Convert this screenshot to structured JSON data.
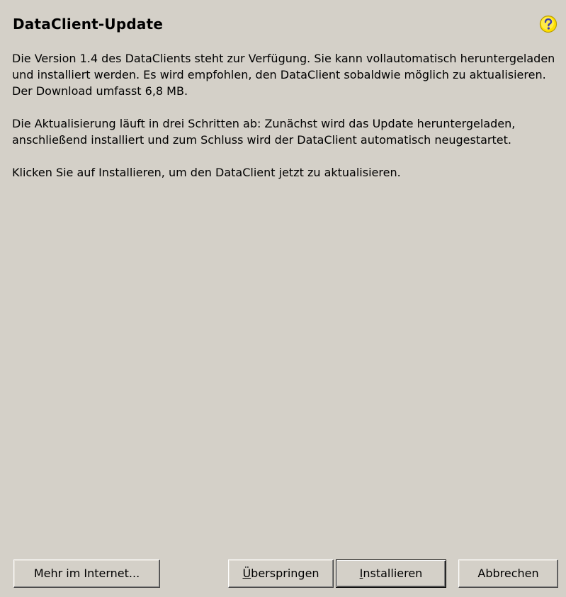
{
  "dialog": {
    "title": "DataClient-Update",
    "help_icon": "help-question-icon",
    "paragraphs": [
      "Die Version 1.4 des DataClients steht zur Verfügung. Sie kann vollautomatisch heruntergeladen und installiert werden. Es wird empfohlen, den DataClient sobaldwie möglich zu aktualisieren. Der Download umfasst 6,8 MB.",
      "Die Aktualisierung läuft in drei Schritten ab: Zunächst wird das Update heruntergeladen, anschließend installiert und zum Schluss wird der DataClient automatisch neugestartet.",
      "Klicken Sie auf Installieren, um den DataClient jetzt zu aktualisieren."
    ]
  },
  "buttons": {
    "more_internet": "Mehr im Internet...",
    "skip_mnemonic": "Ü",
    "skip_rest": "berspringen",
    "install_mnemonic": "I",
    "install_rest": "nstallieren",
    "cancel": "Abbrechen"
  },
  "colors": {
    "background": "#d4d0c8",
    "help_icon_fill": "#ffe100",
    "help_icon_mark": "#3b3bb0"
  }
}
